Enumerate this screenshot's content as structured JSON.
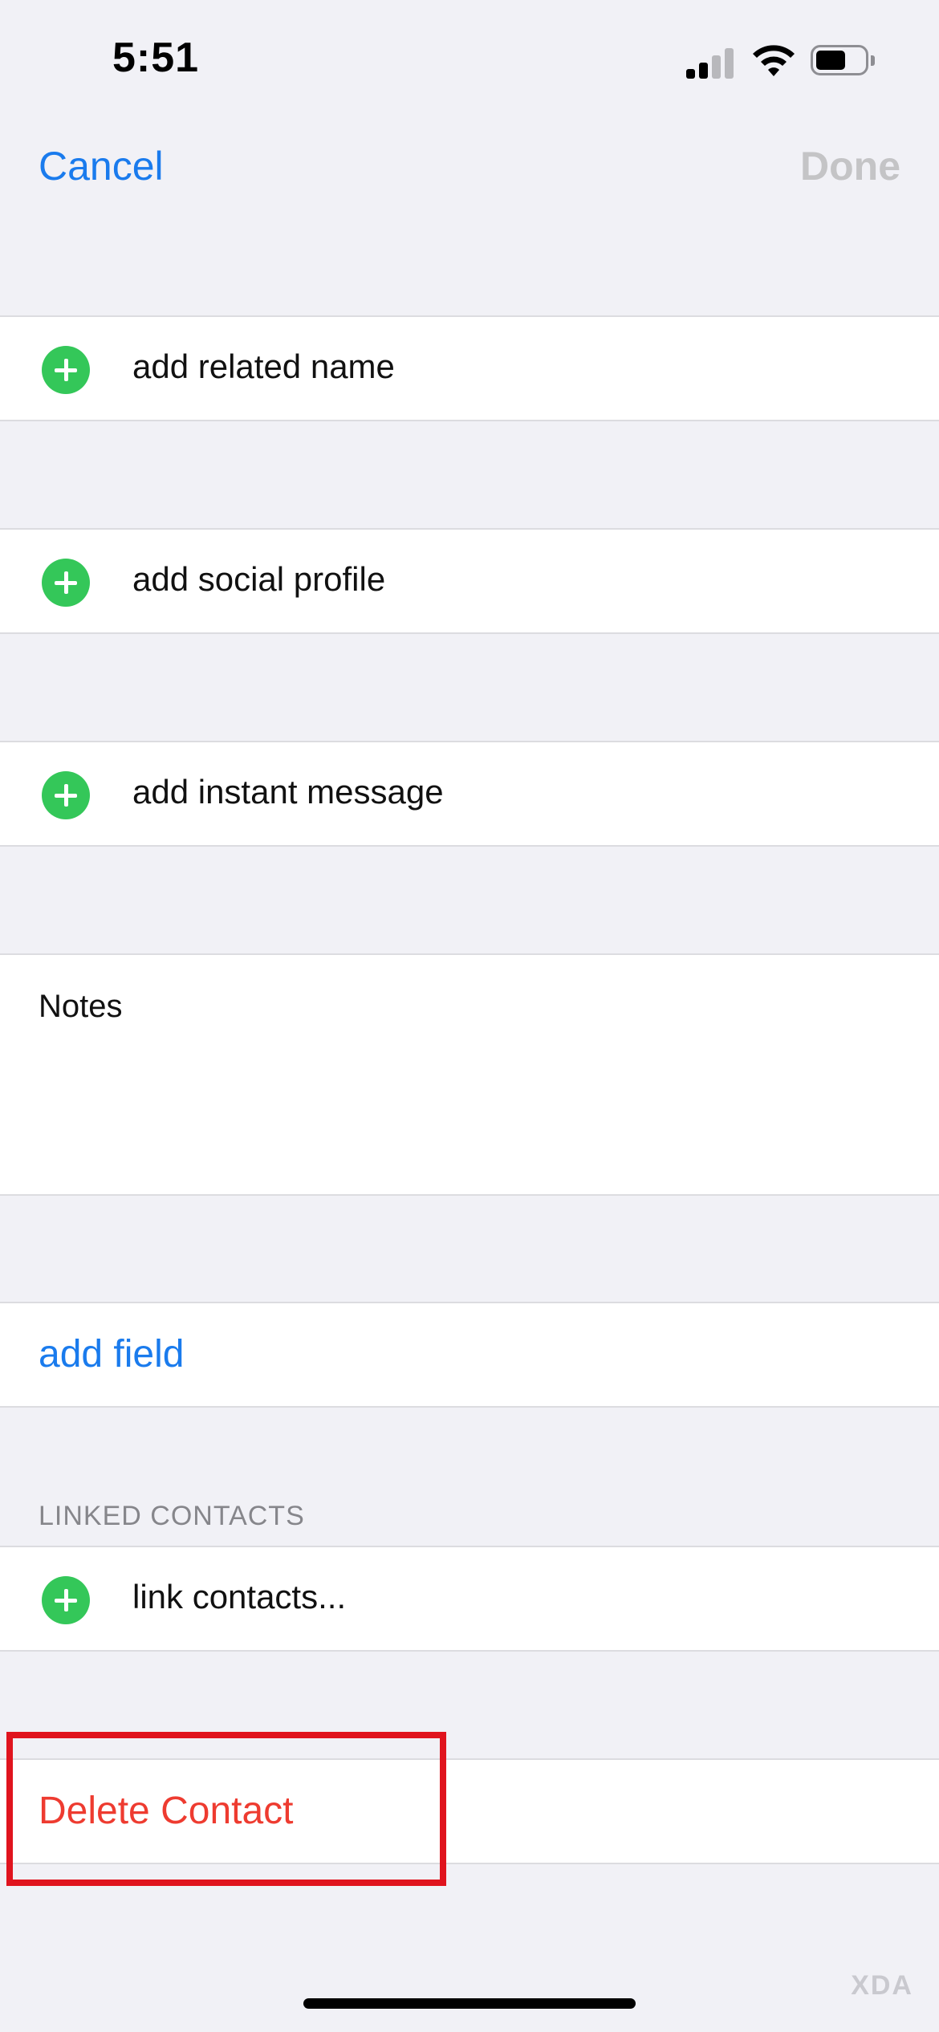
{
  "status_bar": {
    "time": "5:51"
  },
  "nav": {
    "cancel_label": "Cancel",
    "done_label": "Done"
  },
  "rows": {
    "related_name": "add related name",
    "social_profile": "add social profile",
    "instant_message": "add instant message",
    "notes": "Notes",
    "add_field": "add field",
    "linked_header": "LINKED CONTACTS",
    "link_contacts": "link contacts...",
    "delete_contact": "Delete Contact"
  },
  "colors": {
    "accent": "#1a7bed",
    "destructive": "#ee3b30",
    "add_green": "#34c759",
    "highlight_box": "#e0141e",
    "background": "#f1f1f6"
  },
  "watermark": "XDA"
}
